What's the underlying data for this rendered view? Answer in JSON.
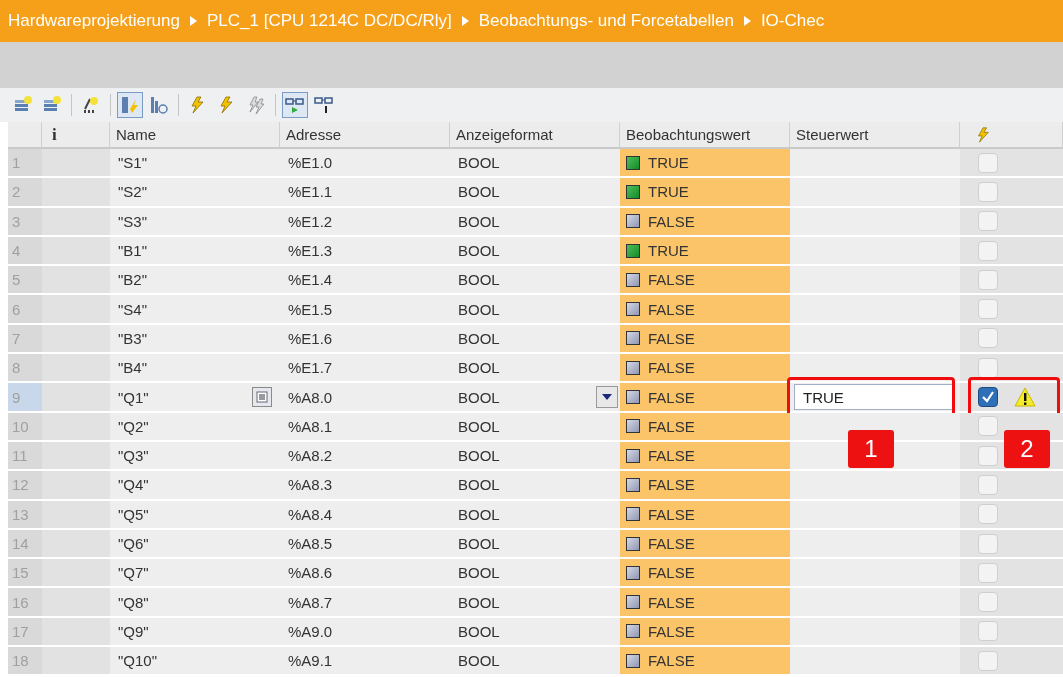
{
  "breadcrumb": [
    "Hardwareprojektierung",
    "PLC_1 [CPU 1214C DC/DC/Rly]",
    "Beobachtungs- und Forcetabellen",
    "IO-Chec"
  ],
  "toolbar": [
    {
      "kind": "insert",
      "pressed": false
    },
    {
      "kind": "insert",
      "pressed": false
    },
    {
      "kind": "range",
      "pressed": false
    },
    {
      "kind": "columns",
      "pressed": true
    },
    {
      "kind": "trigger",
      "pressed": false
    },
    {
      "kind": "bolt",
      "pressed": false
    },
    {
      "kind": "bolt",
      "pressed": false
    },
    {
      "kind": "bolts",
      "pressed": false
    },
    {
      "kind": "monitor",
      "pressed": true
    },
    {
      "kind": "monitor_once",
      "pressed": false
    }
  ],
  "columns": [
    "i",
    "Name",
    "Adresse",
    "Anzeigeformat",
    "Beobachtungswert",
    "Steuerwert"
  ],
  "rows": [
    {
      "number": "1",
      "name": "\"S1\"",
      "address": "%E1.0",
      "format": "BOOL",
      "monitor": "TRUE",
      "on": true,
      "forced": false,
      "selected": false
    },
    {
      "number": "2",
      "name": "\"S2\"",
      "address": "%E1.1",
      "format": "BOOL",
      "monitor": "TRUE",
      "on": true,
      "forced": false,
      "selected": false
    },
    {
      "number": "3",
      "name": "\"S3\"",
      "address": "%E1.2",
      "format": "BOOL",
      "monitor": "FALSE",
      "on": false,
      "forced": false,
      "selected": false
    },
    {
      "number": "4",
      "name": "\"B1\"",
      "address": "%E1.3",
      "format": "BOOL",
      "monitor": "TRUE",
      "on": true,
      "forced": false,
      "selected": false
    },
    {
      "number": "5",
      "name": "\"B2\"",
      "address": "%E1.4",
      "format": "BOOL",
      "monitor": "FALSE",
      "on": false,
      "forced": false,
      "selected": false
    },
    {
      "number": "6",
      "name": "\"S4\"",
      "address": "%E1.5",
      "format": "BOOL",
      "monitor": "FALSE",
      "on": false,
      "forced": false,
      "selected": false
    },
    {
      "number": "7",
      "name": "\"B3\"",
      "address": "%E1.6",
      "format": "BOOL",
      "monitor": "FALSE",
      "on": false,
      "forced": false,
      "selected": false
    },
    {
      "number": "8",
      "name": "\"B4\"",
      "address": "%E1.7",
      "format": "BOOL",
      "monitor": "FALSE",
      "on": false,
      "forced": false,
      "selected": false
    },
    {
      "number": "9",
      "name": "\"Q1\"",
      "address": "%A8.0",
      "format": "BOOL",
      "monitor": "FALSE",
      "on": false,
      "control": "TRUE",
      "control_callout": "1",
      "forced": true,
      "force_callout": "2",
      "warning": true,
      "selected": true
    },
    {
      "number": "10",
      "name": "\"Q2\"",
      "address": "%A8.1",
      "format": "BOOL",
      "monitor": "FALSE",
      "on": false,
      "forced": false,
      "selected": false
    },
    {
      "number": "11",
      "name": "\"Q3\"",
      "address": "%A8.2",
      "format": "BOOL",
      "monitor": "FALSE",
      "on": false,
      "forced": false,
      "selected": false
    },
    {
      "number": "12",
      "name": "\"Q4\"",
      "address": "%A8.3",
      "format": "BOOL",
      "monitor": "FALSE",
      "on": false,
      "forced": false,
      "selected": false
    },
    {
      "number": "13",
      "name": "\"Q5\"",
      "address": "%A8.4",
      "format": "BOOL",
      "monitor": "FALSE",
      "on": false,
      "forced": false,
      "selected": false
    },
    {
      "number": "14",
      "name": "\"Q6\"",
      "address": "%A8.5",
      "format": "BOOL",
      "monitor": "FALSE",
      "on": false,
      "forced": false,
      "selected": false
    },
    {
      "number": "15",
      "name": "\"Q7\"",
      "address": "%A8.6",
      "format": "BOOL",
      "monitor": "FALSE",
      "on": false,
      "forced": false,
      "selected": false
    },
    {
      "number": "16",
      "name": "\"Q8\"",
      "address": "%A8.7",
      "format": "BOOL",
      "monitor": "FALSE",
      "on": false,
      "forced": false,
      "selected": false
    },
    {
      "number": "17",
      "name": "\"Q9\"",
      "address": "%A9.0",
      "format": "BOOL",
      "monitor": "FALSE",
      "on": false,
      "forced": false,
      "selected": false
    },
    {
      "number": "18",
      "name": "\"Q10\"",
      "address": "%A9.1",
      "format": "BOOL",
      "monitor": "FALSE",
      "on": false,
      "forced": false,
      "selected": false
    }
  ]
}
